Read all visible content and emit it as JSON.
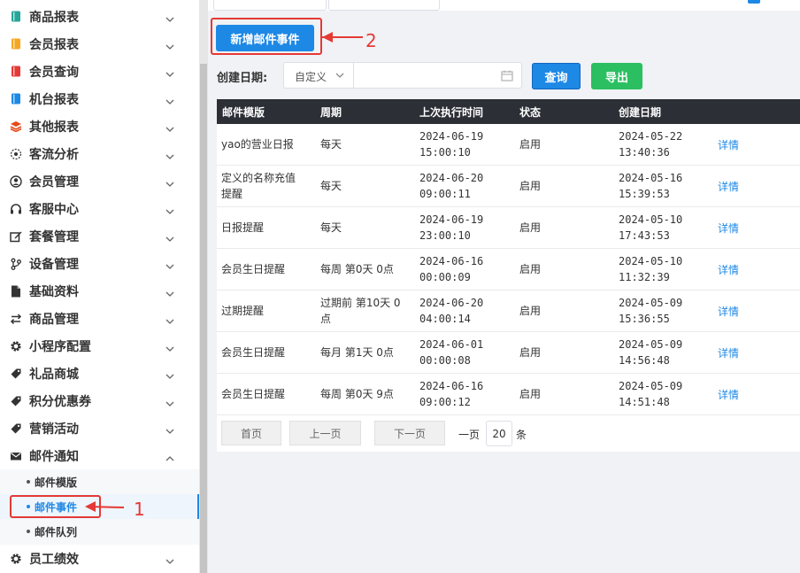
{
  "sidebar": {
    "items": [
      {
        "label": "商品报表",
        "icon": "book-teal-icon",
        "color": "#26a69a"
      },
      {
        "label": "会员报表",
        "icon": "book-orange-icon",
        "color": "#f5a623"
      },
      {
        "label": "会员查询",
        "icon": "book-red-icon",
        "color": "#e53935"
      },
      {
        "label": "机台报表",
        "icon": "book-blue-icon",
        "color": "#1e88e5"
      },
      {
        "label": "其他报表",
        "icon": "layers-icon",
        "color": "#e64a19"
      },
      {
        "label": "客流分析",
        "icon": "target-icon",
        "color": "#333333"
      },
      {
        "label": "会员管理",
        "icon": "user-circle-icon",
        "color": "#333333"
      },
      {
        "label": "客服中心",
        "icon": "headset-icon",
        "color": "#333333"
      },
      {
        "label": "套餐管理",
        "icon": "edit-icon",
        "color": "#333333"
      },
      {
        "label": "设备管理",
        "icon": "fork-icon",
        "color": "#333333"
      },
      {
        "label": "基础资料",
        "icon": "file-icon",
        "color": "#333333"
      },
      {
        "label": "商品管理",
        "icon": "swap-icon",
        "color": "#333333"
      },
      {
        "label": "小程序配置",
        "icon": "gear-icon",
        "color": "#333333"
      },
      {
        "label": "礼品商城",
        "icon": "tag-icon",
        "color": "#333333"
      },
      {
        "label": "积分优惠券",
        "icon": "tag-icon",
        "color": "#333333"
      },
      {
        "label": "营销活动",
        "icon": "tag-icon",
        "color": "#333333"
      },
      {
        "label": "邮件通知",
        "icon": "envelope-icon",
        "color": "#333333"
      }
    ],
    "submenu": [
      "邮件模版",
      "邮件事件",
      "邮件队列"
    ],
    "last_item": {
      "label": "员工绩效",
      "icon": "gear-icon"
    }
  },
  "toolbar": {
    "add_label": "新增邮件事件",
    "query_label": "查询",
    "export_label": "导出",
    "accent": "#1e88e5",
    "export_color": "#2bbf62"
  },
  "filter": {
    "label": "创建日期:",
    "select_value": "自定义"
  },
  "table": {
    "headers": [
      "邮件模版",
      "周期",
      "上次执行时间",
      "状态",
      "创建日期"
    ],
    "detail_label": "详情",
    "rows": [
      {
        "template": [
          "yao的营业日报"
        ],
        "cycle": [
          "每天"
        ],
        "last_run": [
          "2024-06-19",
          "15:00:10"
        ],
        "status": "启用",
        "created": [
          "2024-05-22",
          "13:40:36"
        ]
      },
      {
        "template": [
          "定义的名称充值",
          "提醒"
        ],
        "cycle": [
          "每天"
        ],
        "last_run": [
          "2024-06-20",
          "09:00:11"
        ],
        "status": "启用",
        "created": [
          "2024-05-16",
          "15:39:53"
        ]
      },
      {
        "template": [
          "日报提醒"
        ],
        "cycle": [
          "每天"
        ],
        "last_run": [
          "2024-06-19",
          "23:00:10"
        ],
        "status": "启用",
        "created": [
          "2024-05-10",
          "17:43:53"
        ]
      },
      {
        "template": [
          "会员生日提醒"
        ],
        "cycle": [
          "每周 第0天 0点"
        ],
        "last_run": [
          "2024-06-16",
          "00:00:09"
        ],
        "status": "启用",
        "created": [
          "2024-05-10",
          "11:32:39"
        ]
      },
      {
        "template": [
          "过期提醒"
        ],
        "cycle": [
          "过期前 第10天 0",
          "点"
        ],
        "last_run": [
          "2024-06-20",
          "04:00:14"
        ],
        "status": "启用",
        "created": [
          "2024-05-09",
          "15:36:55"
        ]
      },
      {
        "template": [
          "会员生日提醒"
        ],
        "cycle": [
          "每月 第1天 0点"
        ],
        "last_run": [
          "2024-06-01",
          "00:00:08"
        ],
        "status": "启用",
        "created": [
          "2024-05-09",
          "14:56:48"
        ]
      },
      {
        "template": [
          "会员生日提醒"
        ],
        "cycle": [
          "每周 第0天 9点"
        ],
        "last_run": [
          "2024-06-16",
          "09:00:12"
        ],
        "status": "启用",
        "created": [
          "2024-05-09",
          "14:51:48"
        ]
      }
    ]
  },
  "pagination": {
    "first": "首页",
    "prev": "上一页",
    "next": "下一页",
    "per_page_prefix": "一页",
    "per_page": "20",
    "per_page_suffix": "条"
  },
  "annotations": {
    "one": "1",
    "two": "2",
    "color": "#e53935"
  }
}
